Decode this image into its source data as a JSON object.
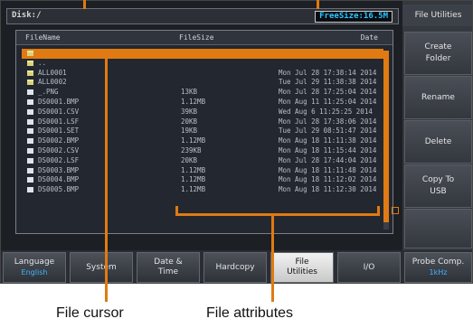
{
  "path": "Disk:/",
  "free_size": "FreeSize:16.5M",
  "columns": {
    "name": "FileName",
    "size": "FileSize",
    "date": "Date"
  },
  "files": [
    {
      "type": "folder",
      "name": "",
      "size": "",
      "date": ""
    },
    {
      "type": "folder",
      "name": "..",
      "size": "",
      "date": ""
    },
    {
      "type": "folder",
      "name": "ALL0001",
      "size": "",
      "date": "Mon Jul 28 17:38:14 2014"
    },
    {
      "type": "folder",
      "name": "ALL0002",
      "size": "",
      "date": "Tue Jul 29 11:38:38 2014"
    },
    {
      "type": "file",
      "name": "_.PNG",
      "size": "13KB",
      "date": "Mon Jul 28 17:25:04 2014"
    },
    {
      "type": "file",
      "name": "DS0001.BMP",
      "size": "1.12MB",
      "date": "Mon Aug 11 11:25:04 2014"
    },
    {
      "type": "file",
      "name": "DS0001.CSV",
      "size": "39KB",
      "date": "Wed Aug 6 11:25:25 2014"
    },
    {
      "type": "file",
      "name": "DS0001.LSF",
      "size": "20KB",
      "date": "Mon Jul 28 17:38:06 2014"
    },
    {
      "type": "file",
      "name": "DS0001.SET",
      "size": "19KB",
      "date": "Tue Jul 29 08:51:47 2014"
    },
    {
      "type": "file",
      "name": "DS0002.BMP",
      "size": "1.12MB",
      "date": "Mon Aug 18 11:11:38 2014"
    },
    {
      "type": "file",
      "name": "DS0002.CSV",
      "size": "239KB",
      "date": "Mon Aug 18 11:15:44 2014"
    },
    {
      "type": "file",
      "name": "DS0002.LSF",
      "size": "20KB",
      "date": "Mon Jul 28 17:44:04 2014"
    },
    {
      "type": "file",
      "name": "DS0003.BMP",
      "size": "1.12MB",
      "date": "Mon Aug 18 11:11:48 2014"
    },
    {
      "type": "file",
      "name": "DS0004.BMP",
      "size": "1.12MB",
      "date": "Mon Aug 18 11:12:02 2014"
    },
    {
      "type": "file",
      "name": "DS0005.BMP",
      "size": "1.12MB",
      "date": "Mon Aug 18 11:12:30 2014"
    }
  ],
  "side_menu": {
    "title": "File Utilities",
    "buttons": [
      "Create\nFolder",
      "Rename",
      "Delete",
      "Copy To\nUSB",
      ""
    ]
  },
  "bottom_menu": [
    {
      "label": "Language",
      "sub": "English",
      "active": false
    },
    {
      "label": "System",
      "sub": "",
      "active": false
    },
    {
      "label": "Date &\nTime",
      "sub": "",
      "active": false
    },
    {
      "label": "Hardcopy",
      "sub": "",
      "active": false
    },
    {
      "label": "File\nUtilities",
      "sub": "",
      "active": true
    },
    {
      "label": "I/O",
      "sub": "",
      "active": false
    },
    {
      "label": "Probe Comp.",
      "sub": "1kHz",
      "active": false
    }
  ],
  "annotations": {
    "file_cursor": "File cursor",
    "file_attributes": "File attributes"
  },
  "colors": {
    "accent": "#e07a12",
    "value_text": "#3fb6ff",
    "free_size_text": "#29c7ff"
  }
}
